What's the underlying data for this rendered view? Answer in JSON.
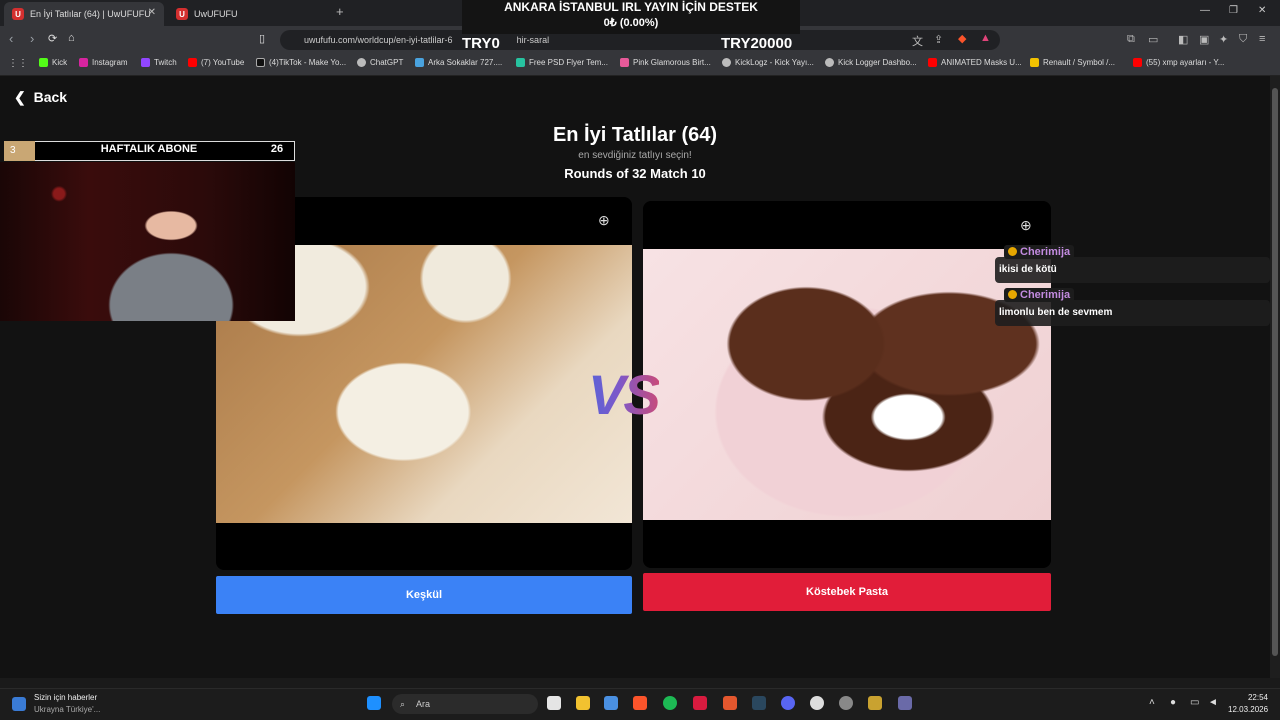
{
  "tabs": [
    {
      "label": "En İyi Tatlılar (64) | UwUFUFU",
      "active": true
    },
    {
      "label": "UwUFUFU",
      "active": false
    }
  ],
  "url": "uwufufu.com/worldcup/en-iyi-tatlilar-6",
  "url_tail": "hir-saral",
  "bookmarks": [
    "Kick",
    "Instagram",
    "Twitch",
    "(7) YouTube",
    "(4)TikTok - Make Yo...",
    "ChatGPT",
    "Arka Sokaklar 727....",
    "Free PSD Flyer Tem...",
    "Pink Glamorous Birt...",
    "KickLogz - Kick Yayı...",
    "Kick Logger Dashbo...",
    "ANIMATED Masks U...",
    "Renault / Symbol /...",
    "(55) xmp ayarları - Y..."
  ],
  "overlay": {
    "title": "ANKARA İSTANBUL IRL YAYIN İÇİN DESTEK",
    "percent": "0₺ (0.00%)",
    "try_left": "TRY0",
    "try_right": "TRY20000"
  },
  "page": {
    "back_label": "Back",
    "title": "En İyi Tatlılar (64)",
    "subtitle": "en sevdiğiniz tatlıyı seçin!",
    "rounds": "Rounds of 32 Match 10",
    "vs": "VS",
    "left_choice": "Keşkül",
    "right_choice": "Köstebek Pasta"
  },
  "webcam": {
    "sub_rank": "3",
    "sub_label": "HAFTALIK ABONE",
    "sub_count": "26"
  },
  "chat": [
    {
      "user": "Cherimija",
      "message": "ikisi de kötü"
    },
    {
      "user": "Cherimija",
      "message": "limonlu ben de sevmem"
    }
  ],
  "taskbar": {
    "news_title": "Sizin için haberler",
    "news_sub": "Ukrayna Türkiye'...",
    "search_placeholder": "Ara",
    "time": "22:54",
    "date": "12.03.2026"
  },
  "colors": {
    "left_button": "#3b82f6",
    "right_button": "#e11d39"
  }
}
